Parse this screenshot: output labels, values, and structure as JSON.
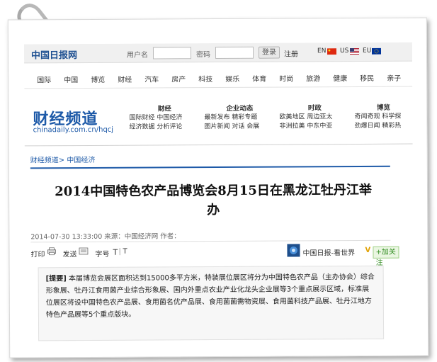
{
  "topbar": {
    "logo": "中国日报网",
    "username_label": "用户名",
    "password_label": "密码",
    "login_button": "登录",
    "register_link": "注册",
    "lang_en": "EN",
    "lang_us": "US",
    "lang_eu": "EU"
  },
  "nav": {
    "items": [
      "国际",
      "中国",
      "博览",
      "财经",
      "汽车",
      "房产",
      "科技",
      "娱乐",
      "体育",
      "时尚",
      "旅游",
      "健康",
      "移民",
      "亲子"
    ]
  },
  "channel": {
    "title": "财经频道",
    "url": "chinadaily.com.cn/hqcj",
    "groups": [
      {
        "heading": "财经",
        "line1": "国际财经 中国经济",
        "line2": "经济数据 分析评论"
      },
      {
        "heading": "企业动态",
        "line1": "最新发布 精彩专题",
        "line2": "图片新闻 对话 会展"
      },
      {
        "heading": "时政",
        "line1": "欧美地区 周边亚太",
        "line2": "非洲拉美 中东中亚"
      },
      {
        "heading": "博览",
        "line1": "奇闻奇观 科学探",
        "line2": "劲爆日闻 精彩热"
      }
    ]
  },
  "breadcrumb": "财经频道> 中国经济",
  "article": {
    "headline_line1": "2014中国特色农产品博览会8月15日在黑龙江牡丹江举",
    "headline_line2": "办",
    "meta": "2014-07-30 13:33:00   来源：中国经济网   作者：",
    "tools": {
      "print": "打印",
      "send": "发送",
      "font": "字号",
      "font_t1": "T",
      "font_sep": "|",
      "font_t2": "T"
    },
    "weibo": "中国日报-看世界",
    "verified_badge": "V",
    "follow": "+加关注",
    "summary_label": "[提要]",
    "summary_text": "本届博览会展区面积达到15000多平方米，特装展位展区将分为中国特色农产品（主办协会）综合形象展、牡丹江食用菌产业综合形象展、国内外重点农业产业化龙头企业展等3个重点展示区域，标准展位展区将设中国特色农产品展、食用菌名优产品展、食用菌菌需物资展、食用菌科技产品展、牡丹江地方特色产品展等5个重点版块。"
  },
  "colors": {
    "brand_blue": "#1e5aa8",
    "follow_green": "#2e8b1d"
  }
}
